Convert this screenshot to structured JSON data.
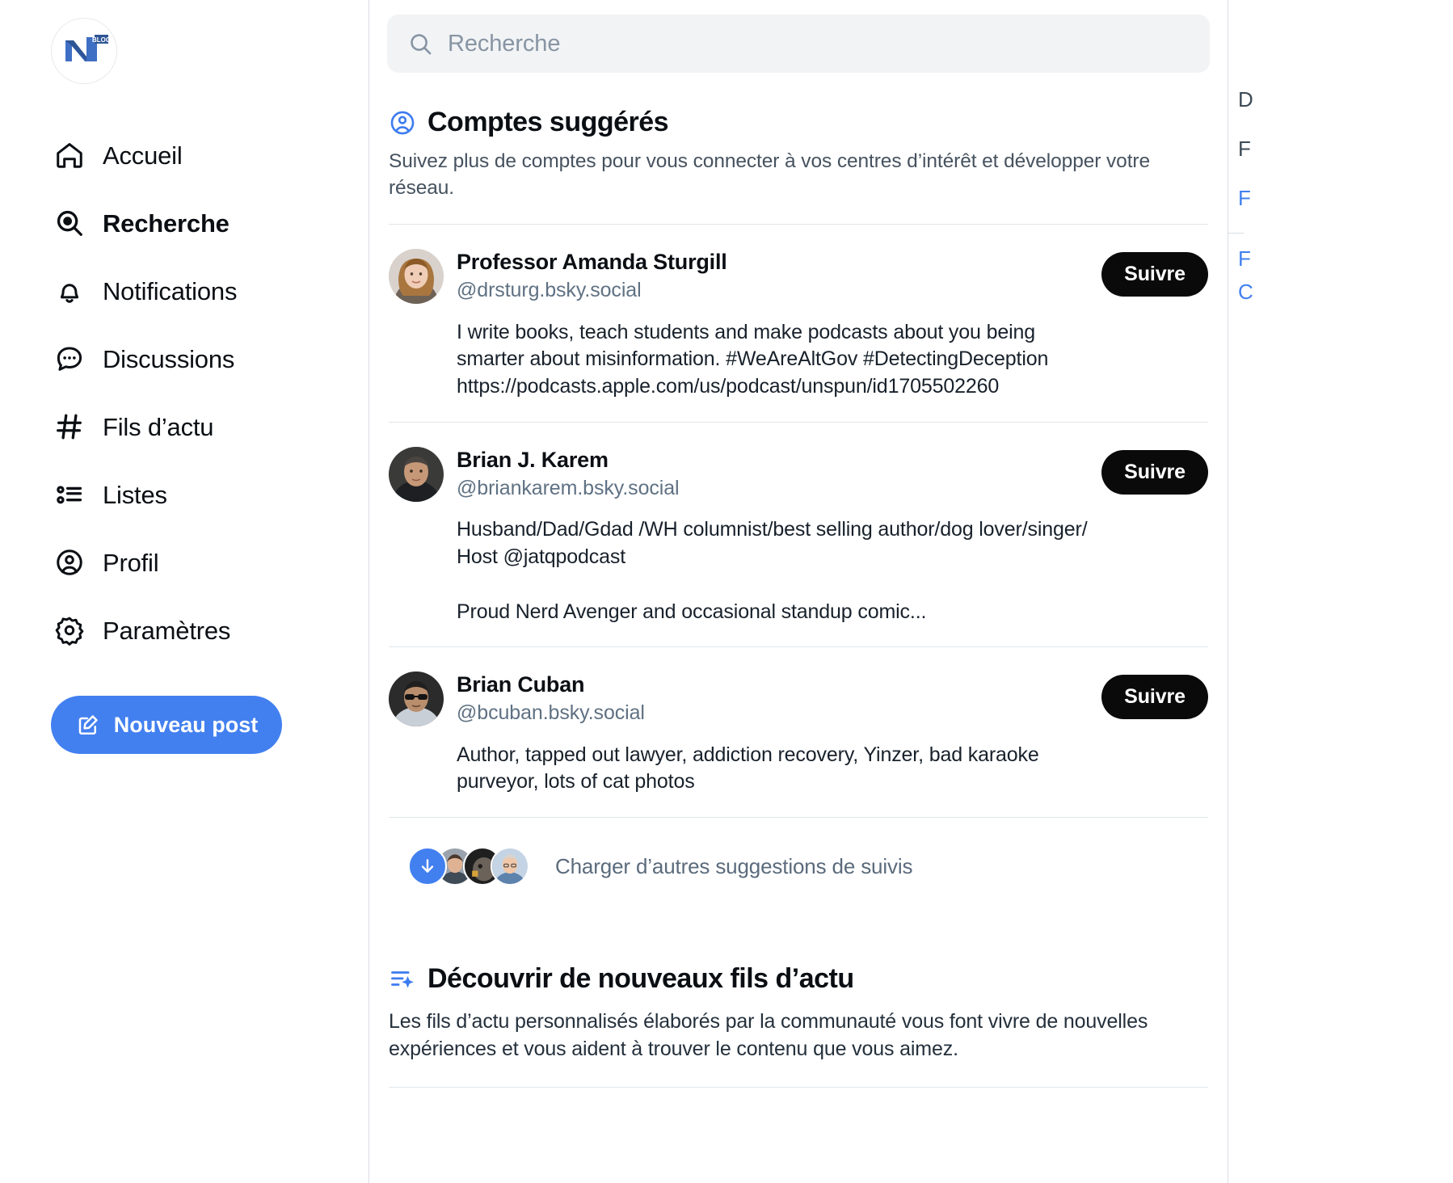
{
  "brand": {
    "logo_text": "NT",
    "logo_badge": "BLOG"
  },
  "sidebar": {
    "items": [
      {
        "label": "Accueil",
        "icon": "home-icon",
        "active": false
      },
      {
        "label": "Recherche",
        "icon": "search-icon",
        "active": true
      },
      {
        "label": "Notifications",
        "icon": "bell-icon",
        "active": false
      },
      {
        "label": "Discussions",
        "icon": "chat-bubble-icon",
        "active": false
      },
      {
        "label": "Fils d’actu",
        "icon": "hashtag-icon",
        "active": false
      },
      {
        "label": "Listes",
        "icon": "list-icon",
        "active": false
      },
      {
        "label": "Profil",
        "icon": "user-circle-icon",
        "active": false
      },
      {
        "label": "Paramètres",
        "icon": "gear-icon",
        "active": false
      }
    ],
    "compose_label": "Nouveau post",
    "compose_icon": "compose-pencil-icon",
    "compose_color": "#4280f0"
  },
  "search": {
    "placeholder": "Recherche",
    "value": "",
    "icon": "search-icon"
  },
  "suggested": {
    "icon": "person-circle-icon",
    "title": "Comptes suggérés",
    "description": "Suivez plus de comptes pour vous connecter à vos centres d’intérêt et développer votre réseau.",
    "follow_label": "Suivre",
    "accounts": [
      {
        "name": "Professor Amanda Sturgill",
        "handle": "@drsturg.bsky.social",
        "bio": "I write books, teach students and make podcasts about you being smarter about misinformation. #WeAreAltGov #DetectingDeception https://podcasts.apple.com/us/podcast/unspun/id1705502260",
        "follow_label": "Suivre"
      },
      {
        "name": "Brian J. Karem",
        "handle": "@briankarem.bsky.social",
        "bio": "Husband/Dad/Gdad /WH columnist/best selling author/dog lover/singer/ Host @jatqpodcast\n\nProud Nerd Avenger and occasional standup comic...",
        "follow_label": "Suivre"
      },
      {
        "name": "Brian Cuban",
        "handle": "@bcuban.bsky.social",
        "bio": "Author, tapped out lawyer, addiction recovery, Yinzer, bad karaoke purveyor, lots of cat photos",
        "follow_label": "Suivre"
      }
    ],
    "load_more_label": "Charger d’autres suggestions de suivis",
    "load_more_icon": "arrow-down-icon"
  },
  "feeds": {
    "icon": "feed-sparkle-icon",
    "title": "Découvrir de nouveaux fils d’actu",
    "description": "Les fils d’actu personnalisés élaborés par la communauté vous font vivre de nouvelles expériences et vous aident à trouver le contenu que vous aimez."
  },
  "right_rail": {
    "lines": [
      {
        "text": "D",
        "link": false
      },
      {
        "text": "F",
        "link": false
      },
      {
        "text": "F",
        "link": true
      }
    ],
    "lines2": [
      {
        "text": "F",
        "link": true
      },
      {
        "text": "C",
        "link": true
      }
    ]
  },
  "colors": {
    "accent": "#4280f0",
    "follow_button": "#0a0a0a",
    "text_primary": "#0b0f14",
    "text_muted": "#5f7183",
    "divider": "#e2e6ea",
    "search_bg": "#f1f3f5"
  }
}
